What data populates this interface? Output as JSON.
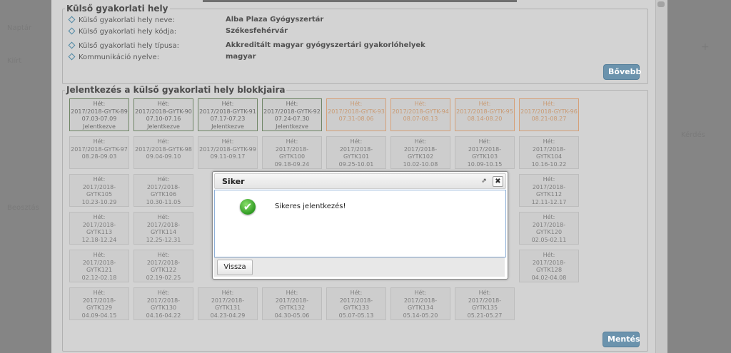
{
  "left_panel": {
    "items": [
      "Naptár",
      "Kiírt",
      "",
      "",
      "Beosztás"
    ]
  },
  "right_panel": {
    "items": [
      "+",
      "Kérdés"
    ]
  },
  "external_site": {
    "legend": "Külső gyakorlati hely",
    "fields": [
      {
        "label": "Külső gyakorlati hely neve:",
        "value": "Alba Plaza Gyógyszertár"
      },
      {
        "label": "Külső gyakorlati hely kódja:",
        "value": "Székesfehérvár"
      },
      {
        "label": "Külső gyakorlati hely típusa:",
        "value": "Akkreditált magyar gyógyszertári gyakorlóhelyek"
      },
      {
        "label": "Kommunikáció nyelve:",
        "value": "magyar"
      }
    ],
    "more_button": "Bővebb"
  },
  "blocks_section": {
    "legend": "Jelentkezés a külső gyakorlati hely blokkjaira",
    "blocks": [
      {
        "week": "Hét:",
        "code": "2017/2018-GYTK-89",
        "dates": "07.03-07.09",
        "status": "Jelentkezve",
        "state": "green"
      },
      {
        "week": "Hét:",
        "code": "2017/2018-GYTK-90",
        "dates": "07.10-07.16",
        "status": "Jelentkezve",
        "state": "green"
      },
      {
        "week": "Hét:",
        "code": "2017/2018-GYTK-91",
        "dates": "07.17-07.23",
        "status": "Jelentkezve",
        "state": "green"
      },
      {
        "week": "Hét:",
        "code": "2017/2018-GYTK-92",
        "dates": "07.24-07.30",
        "status": "Jelentkezve",
        "state": "green"
      },
      {
        "week": "Hét:",
        "code": "2017/2018-GYTK-93",
        "dates": "07.31-08.06",
        "status": "",
        "state": "orange"
      },
      {
        "week": "Hét:",
        "code": "2017/2018-GYTK-94",
        "dates": "08.07-08.13",
        "status": "",
        "state": "orange"
      },
      {
        "week": "Hét:",
        "code": "2017/2018-GYTK-95",
        "dates": "08.14-08.20",
        "status": "",
        "state": "orange"
      },
      {
        "week": "Hét:",
        "code": "2017/2018-GYTK-96",
        "dates": "08.21-08.27",
        "status": "",
        "state": "orange"
      },
      {
        "week": "Hét:",
        "code": "2017/2018-GYTK-97",
        "dates": "08.28-09.03",
        "status": "",
        "state": "gray"
      },
      {
        "week": "Hét:",
        "code": "2017/2018-GYTK-98",
        "dates": "09.04-09.10",
        "status": "",
        "state": "gray"
      },
      {
        "week": "Hét:",
        "code": "2017/2018-GYTK-99",
        "dates": "09.11-09.17",
        "status": "",
        "state": "gray"
      },
      {
        "week": "Hét:",
        "code": "2017/2018-",
        "code2": "GYTK100",
        "dates": "09.18-09.24",
        "state": "gray"
      },
      {
        "week": "Hét:",
        "code": "2017/2018-",
        "code2": "GYTK101",
        "dates": "09.25-10.01",
        "state": "gray"
      },
      {
        "week": "Hét:",
        "code": "2017/2018-",
        "code2": "GYTK102",
        "dates": "10.02-10.08",
        "state": "gray"
      },
      {
        "week": "Hét:",
        "code": "2017/2018-",
        "code2": "GYTK103",
        "dates": "10.09-10.15",
        "state": "gray"
      },
      {
        "week": "Hét:",
        "code": "2017/2018-",
        "code2": "GYTK104",
        "dates": "10.16-10.22",
        "state": "gray"
      },
      {
        "week": "Hét:",
        "code": "2017/2018-",
        "code2": "GYTK105",
        "dates": "10.23-10.29",
        "state": "gray"
      },
      {
        "week": "Hét:",
        "code": "2017/2018-",
        "code2": "GYTK106",
        "dates": "10.30-11.05",
        "state": "gray"
      },
      {
        "week": "Hét:",
        "code": "2017/2018-",
        "code2": "GYTK112",
        "dates": "12.11-12.17",
        "state": "gray"
      },
      {
        "week": "Hét:",
        "code": "2017/2018-",
        "code2": "GYTK113",
        "dates": "12.18-12.24",
        "state": "gray"
      },
      {
        "week": "Hét:",
        "code": "2017/2018-",
        "code2": "GYTK114",
        "dates": "12.25-12.31",
        "state": "gray"
      },
      {
        "week": "Hét:",
        "code": "2017/2018-",
        "code2": "GYTK120",
        "dates": "02.05-02.11",
        "state": "gray"
      },
      {
        "week": "Hét:",
        "code": "2017/2018-",
        "code2": "GYTK121",
        "dates": "02.12-02.18",
        "state": "gray"
      },
      {
        "week": "Hét:",
        "code": "2017/2018-",
        "code2": "GYTK122",
        "dates": "02.19-02.25",
        "state": "gray"
      },
      {
        "week": "Hét:",
        "code": "2017/2018-",
        "code2": "GYTK128",
        "dates": "04.02-04.08",
        "state": "gray"
      },
      {
        "week": "Hét:",
        "code": "2017/2018-",
        "code2": "GYTK129",
        "dates": "04.09-04.15",
        "state": "gray"
      },
      {
        "week": "Hét:",
        "code": "2017/2018-",
        "code2": "GYTK130",
        "dates": "04.16-04.22",
        "state": "gray"
      },
      {
        "week": "Hét:",
        "code": "2017/2018-",
        "code2": "GYTK131",
        "dates": "04.23-04.29",
        "state": "gray"
      },
      {
        "week": "Hét:",
        "code": "2017/2018-",
        "code2": "GYTK132",
        "dates": "04.30-05.06",
        "state": "gray"
      },
      {
        "week": "Hét:",
        "code": "2017/2018-",
        "code2": "GYTK133",
        "dates": "05.07-05.13",
        "state": "gray"
      },
      {
        "week": "Hét:",
        "code": "2017/2018-",
        "code2": "GYTK134",
        "dates": "05.14-05.20",
        "state": "gray"
      },
      {
        "week": "Hét:",
        "code": "2017/2018-",
        "code2": "GYTK135",
        "dates": "05.21-05.27",
        "state": "gray"
      }
    ],
    "save_button": "Mentés"
  },
  "dialog": {
    "title": "Siker",
    "message": "Sikeres jelentkezés!",
    "back_button": "Vissza",
    "check_icon": "✔",
    "close_icon": "✖",
    "external_icon": "⇗"
  }
}
